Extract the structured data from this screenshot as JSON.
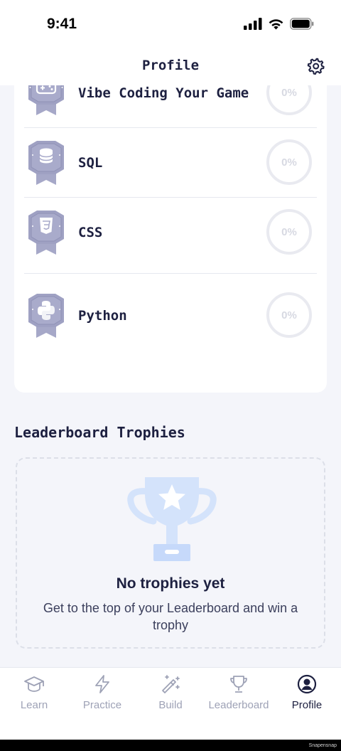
{
  "status": {
    "time": "9:41"
  },
  "header": {
    "title": "Profile"
  },
  "courses": [
    {
      "name": "Vibe Coding Your Game",
      "progress": "0%",
      "icon": "gamepad-icon"
    },
    {
      "name": "SQL",
      "progress": "0%",
      "icon": "database-icon"
    },
    {
      "name": "CSS",
      "progress": "0%",
      "icon": "css-shield-icon"
    },
    {
      "name": "Python",
      "progress": "0%",
      "icon": "python-icon"
    }
  ],
  "leaderboard_trophies": {
    "title": "Leaderboard Trophies",
    "empty_title": "No trophies yet",
    "empty_description": "Get to the top of your Leaderboard and win a trophy"
  },
  "tabs": [
    {
      "label": "Learn",
      "icon": "graduation-cap-icon",
      "active": false
    },
    {
      "label": "Practice",
      "icon": "lightning-icon",
      "active": false
    },
    {
      "label": "Build",
      "icon": "magic-wand-icon",
      "active": false
    },
    {
      "label": "Leaderboard",
      "icon": "trophy-icon",
      "active": false
    },
    {
      "label": "Profile",
      "icon": "profile-icon",
      "active": true
    }
  ],
  "watermark": "Snapensnap",
  "colors": {
    "badge": "#a6a8c8",
    "badge_dark": "#8d8fb4",
    "accent_dark": "#1d2040",
    "trophy": "#cfe0fb"
  }
}
